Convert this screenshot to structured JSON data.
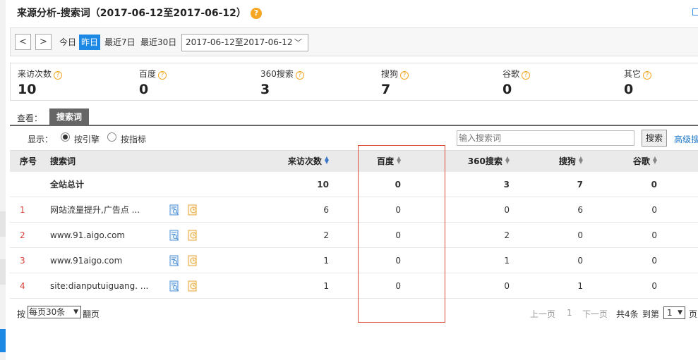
{
  "title": "来源分析-搜索词（2017-06-12至2017-06-12）",
  "help_glyph": "?",
  "toolbar": {
    "prev": "<",
    "next": ">",
    "today": "今日",
    "yesterday": "昨日",
    "last7": "最近7日",
    "last30": "最近30日",
    "date_range": "2017-06-12至2017-06-12"
  },
  "stats": [
    {
      "label": "来访次数",
      "value": "10"
    },
    {
      "label": "百度",
      "value": "0"
    },
    {
      "label": "360搜索",
      "value": "3"
    },
    {
      "label": "搜狗",
      "value": "7"
    },
    {
      "label": "谷歌",
      "value": "0"
    },
    {
      "label": "其它",
      "value": "0"
    }
  ],
  "view": {
    "label": "查看：",
    "tab": "搜索词"
  },
  "display": {
    "label": "显示：",
    "option1": "按引擎",
    "option2": "按指标",
    "selected": "按引擎",
    "search_placeholder": "输入搜索词",
    "search_button": "搜索",
    "advanced": "高级搜"
  },
  "table": {
    "headers": {
      "idx": "序号",
      "keyword": "搜索词",
      "visits": "来访次数",
      "baidu": "百度",
      "s360": "360搜索",
      "sogou": "搜狗",
      "google": "谷歌"
    },
    "total": {
      "keyword": "全站总计",
      "visits": "10",
      "baidu": "0",
      "s360": "3",
      "sogou": "7",
      "google": "0"
    },
    "rows": [
      {
        "idx": "1",
        "keyword": "网站流量提升,广告点 ...",
        "visits": "6",
        "baidu": "0",
        "s360": "0",
        "sogou": "6",
        "google": "0"
      },
      {
        "idx": "2",
        "keyword": "www.91.aigo.com",
        "visits": "2",
        "baidu": "0",
        "s360": "2",
        "sogou": "0",
        "google": "0"
      },
      {
        "idx": "3",
        "keyword": "www.91aigo.com",
        "visits": "1",
        "baidu": "0",
        "s360": "1",
        "sogou": "0",
        "google": "0"
      },
      {
        "idx": "4",
        "keyword": "site:dianputuiguang. ...",
        "visits": "1",
        "baidu": "0",
        "s360": "0",
        "sogou": "1",
        "google": "0"
      }
    ]
  },
  "pager": {
    "by": "按",
    "per_page": "每页30条",
    "turn": "翻页",
    "prev": "上一页",
    "current": "1",
    "next": "下一页",
    "total": "共4条",
    "goto": "到第",
    "page_value": "1",
    "page_suffix": "页"
  },
  "colors": {
    "accent": "#1e88e5",
    "highlight": "#e04a3a",
    "help": "#f5a623",
    "index": "#d9453c"
  }
}
